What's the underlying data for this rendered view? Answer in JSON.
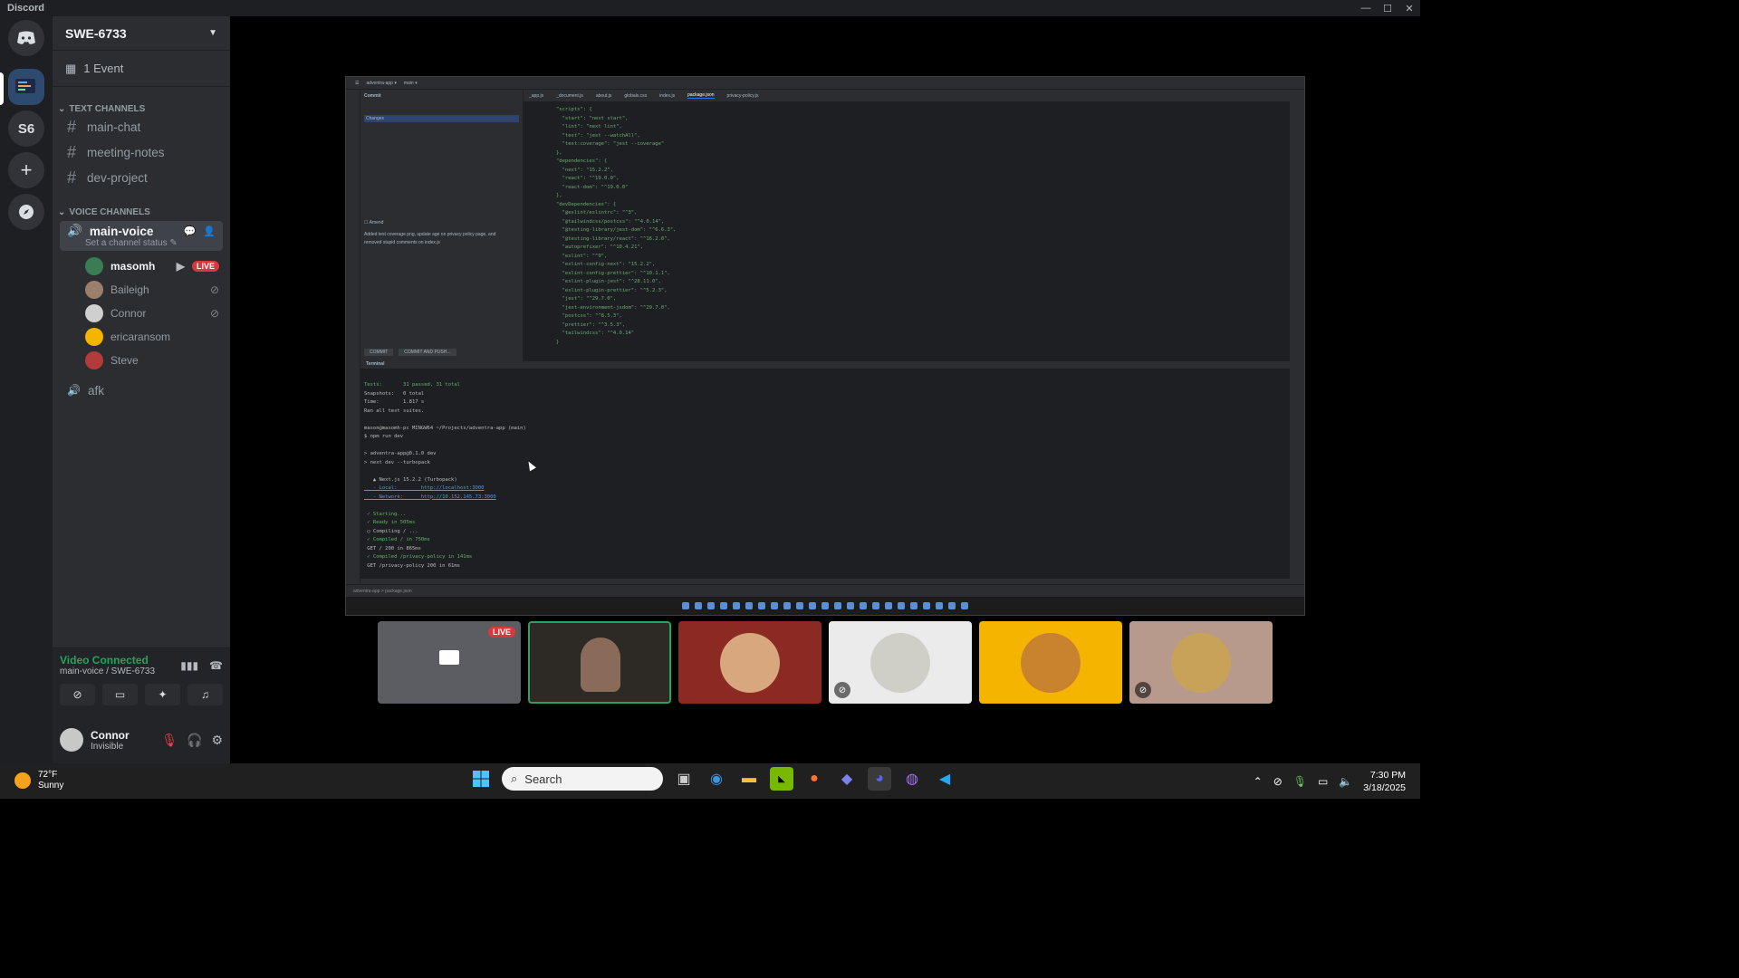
{
  "window": {
    "app_name": "Discord"
  },
  "guilds": {
    "s6_label": "S6"
  },
  "server": {
    "name": "SWE-6733",
    "event": "1 Event"
  },
  "categories": {
    "text": "TEXT CHANNELS",
    "voice": "VOICE CHANNELS"
  },
  "text_channels": [
    {
      "label": "main-chat"
    },
    {
      "label": "meeting-notes"
    },
    {
      "label": "dev-project"
    }
  ],
  "voice": {
    "channel": "main-voice",
    "status": "Set a channel status",
    "members": [
      {
        "name": "masomh",
        "live": "LIVE",
        "color": "#3a7d54"
      },
      {
        "name": "Baileigh",
        "color": "#9a7f6a"
      },
      {
        "name": "Connor",
        "color": "#cfcfcf"
      },
      {
        "name": "ericaransom",
        "color": "#f5b400"
      },
      {
        "name": "Steve",
        "color": "#b43b3b"
      }
    ],
    "afk": "afk"
  },
  "voice_bar": {
    "title": "Video Connected",
    "sub": "main-voice / SWE-6733"
  },
  "user": {
    "name": "Connor",
    "status": "Invisible"
  },
  "stream": {
    "tabs": [
      "_app.js",
      "_document.js",
      "about.js",
      "globals.css",
      "index.js",
      "package.json",
      "privacy-policy.js"
    ],
    "commit_title": "Commit",
    "changes_label": "Changes",
    "amend": "Amend",
    "commit_message": "Added test coverage png, update age on privacy policy page, and removed stupid comments on index.js",
    "commit_btn": "COMMIT",
    "commit_push_btn": "COMMIT AND PUSH...",
    "terminal_tab": "Terminal",
    "status_path": "adventra-app > package.json",
    "editor_lines": [
      "\"scripts\": {",
      "  \"start\": \"next start\",",
      "  \"lint\": \"next lint\",",
      "  \"test\": \"jest --watchAll\",",
      "  \"test:coverage\": \"jest --coverage\"",
      "},",
      "\"dependencies\": {",
      "  \"next\": \"15.2.2\",",
      "  \"react\": \"^19.0.0\",",
      "  \"react-dom\": \"^19.0.0\"",
      "},",
      "\"devDependencies\": {",
      "  \"@eslint/eslintrc\": \"^3\",",
      "  \"@tailwindcss/postcss\": \"^4.0.14\",",
      "  \"@testing-library/jest-dom\": \"^6.6.3\",",
      "  \"@testing-library/react\": \"^16.2.0\",",
      "  \"autoprefixer\": \"^10.4.21\",",
      "  \"eslint\": \"^9\",",
      "  \"eslint-config-next\": \"15.2.2\",",
      "  \"eslint-config-prettier\": \"^10.1.1\",",
      "  \"eslint-plugin-jest\": \"^28.11.0\",",
      "  \"eslint-plugin-prettier\": \"^5.2.3\",",
      "  \"jest\": \"^29.7.0\",",
      "  \"jest-environment-jsdom\": \"^29.7.0\",",
      "  \"postcss\": \"^8.5.3\",",
      "  \"prettier\": \"^3.5.3\",",
      "  \"tailwindcss\": \"^4.0.14\"",
      "}"
    ],
    "terminal_lines": [
      "Tests:       31 passed, 31 total",
      "Snapshots:   0 total",
      "Time:        1.817 s",
      "Ran all test suites.",
      "",
      "mason@masomh-pc MINGW64 ~/Projects/adventra-app (main)",
      "$ npm run dev",
      "",
      "> adventra-app@0.1.0 dev",
      "> next dev --turbopack",
      "",
      "   ▲ Next.js 15.2.2 (Turbopack)",
      "   - Local:        http://localhost:3000",
      "   - Network:      http://10.152.145.73:3000",
      "",
      " ✓ Starting...",
      " ✓ Ready in 505ms",
      " ○ Compiling / ...",
      " ✓ Compiled / in 750ms",
      " GET / 200 in 865ms",
      " ✓ Compiled /privacy-policy in 141ms",
      " GET /privacy-policy 200 in 61ms"
    ]
  },
  "tiles": [
    {
      "kind": "screen",
      "live": "LIVE",
      "bg": "#5b5d62"
    },
    {
      "kind": "camera",
      "bg": "#2d2a26",
      "border": "#23a55a"
    },
    {
      "kind": "avatar",
      "bg": "#8a2a22",
      "avatar": "#d9a77d",
      "muted": false
    },
    {
      "kind": "avatar",
      "bg": "#ebebeb",
      "avatar": "#cfcfc8",
      "muted": true
    },
    {
      "kind": "avatar",
      "bg": "#f5b400",
      "avatar": "#c9832f",
      "muted": false
    },
    {
      "kind": "avatar",
      "bg": "#b79a8c",
      "avatar": "#c9a25a",
      "muted": true
    }
  ],
  "taskbar": {
    "temp": "72°F",
    "weather": "Sunny",
    "search_placeholder": "Search",
    "time": "7:30 PM",
    "date": "3/18/2025"
  }
}
